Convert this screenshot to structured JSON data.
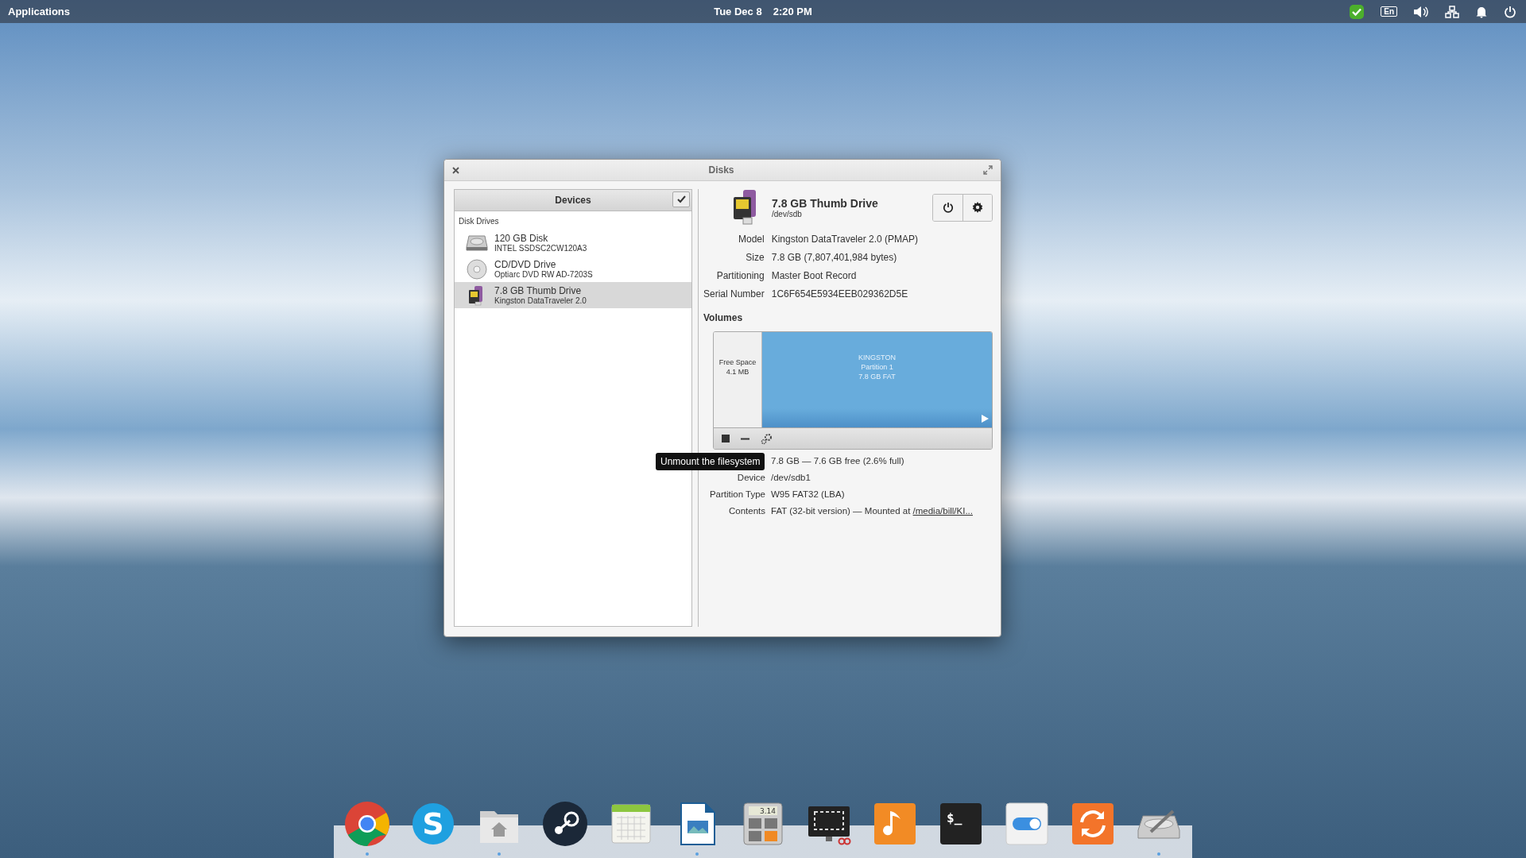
{
  "top_bar": {
    "menu": "Applications",
    "date": "Tue Dec  8",
    "time": "2:20 PM",
    "indicators": [
      {
        "kind": "check"
      },
      {
        "kind": "keyboard",
        "label": "En"
      },
      {
        "kind": "volume"
      },
      {
        "kind": "network"
      },
      {
        "kind": "notifications"
      },
      {
        "kind": "power"
      }
    ]
  },
  "window": {
    "title": "Disks"
  },
  "devices": {
    "title": "Devices",
    "section": "Disk Drives",
    "items": [
      {
        "kind": "hdd",
        "name": "120 GB Disk",
        "detail": "INTEL SSDSC2CW120A3",
        "selected": false
      },
      {
        "kind": "optical",
        "name": "CD/DVD Drive",
        "detail": "Optiarc DVD RW AD-7203S",
        "selected": false
      },
      {
        "kind": "usb",
        "name": "7.8 GB Thumb Drive",
        "detail": "Kingston DataTraveler 2.0",
        "selected": true
      }
    ]
  },
  "drive": {
    "kind": "usb",
    "name": "7.8 GB Thumb Drive",
    "path": "/dev/sdb",
    "fields": [
      {
        "label": "Model",
        "value": "Kingston DataTraveler 2.0 (PMAP)"
      },
      {
        "label": "Size",
        "value": "7.8 GB (7,807,401,984 bytes)"
      },
      {
        "label": "Partitioning",
        "value": "Master Boot Record"
      },
      {
        "label": "Serial Number",
        "value": "1C6F654E5934EEB029362D5E"
      }
    ]
  },
  "volumes": {
    "title": "Volumes",
    "segments": [
      {
        "kind": "free",
        "lines": [
          "Free Space",
          "4.1 MB"
        ],
        "selected": false
      },
      {
        "kind": "partition",
        "lines": [
          "KINGSTON",
          "Partition 1",
          "7.8 GB FAT"
        ],
        "selected": true
      }
    ],
    "fields": [
      {
        "value": "7.8 GB — 7.6 GB free (2.6% full)"
      },
      {
        "label": "Device",
        "value": "/dev/sdb1"
      },
      {
        "label": "Partition Type",
        "value": "W95 FAT32 (LBA)"
      },
      {
        "label": "Contents",
        "value": "FAT (32-bit version) — Mounted at ",
        "link": "/media/bill/KI..."
      }
    ]
  },
  "tooltip": "Unmount the filesystem",
  "dock": [
    {
      "kind": "chrome",
      "running": true
    },
    {
      "kind": "skype",
      "label": "S",
      "running": false
    },
    {
      "kind": "files",
      "running": true
    },
    {
      "kind": "steam",
      "running": false
    },
    {
      "kind": "calendar",
      "running": false
    },
    {
      "kind": "writer",
      "running": true
    },
    {
      "kind": "calculator",
      "label": "3.14",
      "running": false
    },
    {
      "kind": "screenshot",
      "running": false
    },
    {
      "kind": "music",
      "running": false
    },
    {
      "kind": "terminal",
      "label": "$_",
      "running": false
    },
    {
      "kind": "switch",
      "running": false
    },
    {
      "kind": "update",
      "running": false
    },
    {
      "kind": "disks",
      "running": true
    }
  ]
}
